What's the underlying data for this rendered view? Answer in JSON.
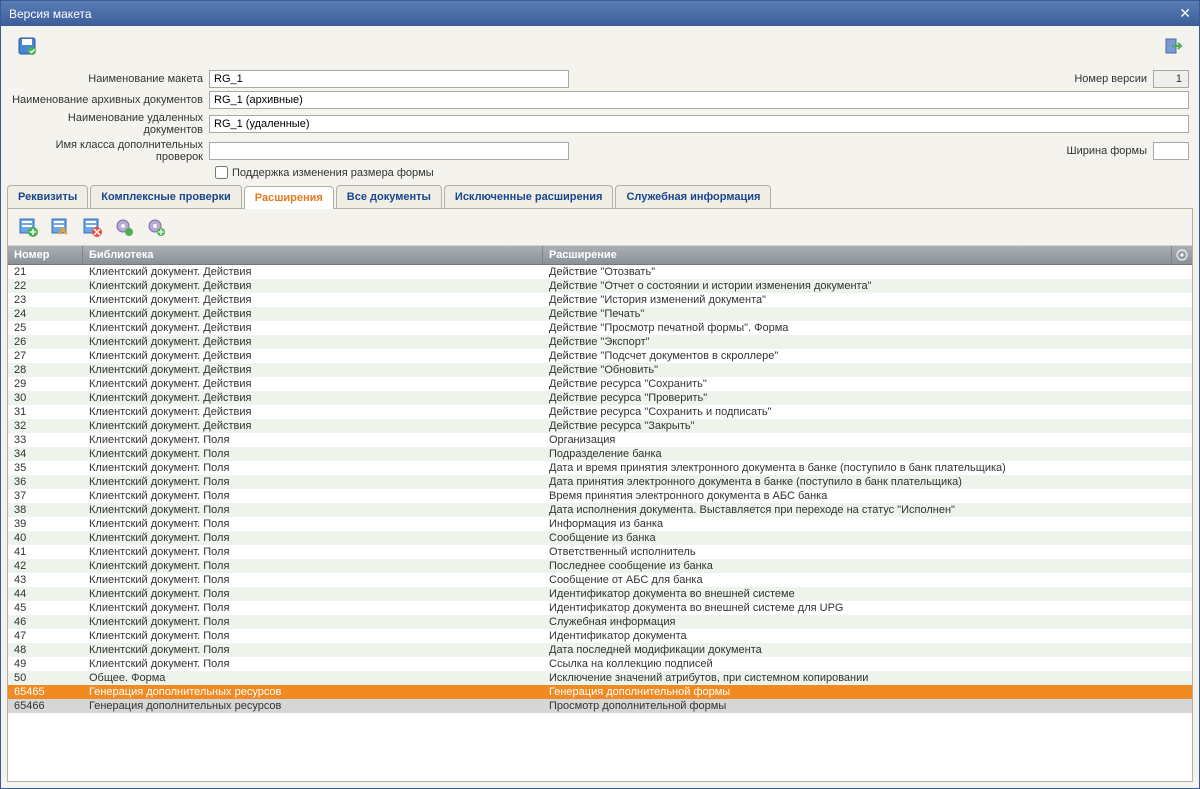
{
  "window": {
    "title": "Версия макета"
  },
  "form": {
    "label_name": "Наименование макета",
    "name_value": "RG_1",
    "label_version": "Номер версии",
    "version_value": "1",
    "label_archive": "Наименование архивных документов",
    "archive_value": "RG_1 (архивные)",
    "label_deleted": "Наименование удаленных документов",
    "deleted_value": "RG_1 (удаленные)",
    "label_class": "Имя класса дополнительных проверок",
    "class_value": "",
    "label_width": "Ширина формы",
    "width_value": "",
    "checkbox_label": "Поддержка изменения размера формы"
  },
  "tabs": [
    "Реквизиты",
    "Комплексные проверки",
    "Расширения",
    "Все документы",
    "Исключенные расширения",
    "Служебная информация"
  ],
  "grid": {
    "headers": {
      "num": "Номер",
      "lib": "Библиотека",
      "ext": "Расширение"
    },
    "rows": [
      {
        "num": "21",
        "lib": "Клиентский документ. Действия",
        "ext": "Действие \"Отозвать\""
      },
      {
        "num": "22",
        "lib": "Клиентский документ. Действия",
        "ext": "Действие \"Отчет о состоянии и истории изменения документа\""
      },
      {
        "num": "23",
        "lib": "Клиентский документ. Действия",
        "ext": "Действие \"История изменений документа\""
      },
      {
        "num": "24",
        "lib": "Клиентский документ. Действия",
        "ext": "Действие \"Печать\""
      },
      {
        "num": "25",
        "lib": "Клиентский документ. Действия",
        "ext": "Действие \"Просмотр печатной формы\". Форма"
      },
      {
        "num": "26",
        "lib": "Клиентский документ. Действия",
        "ext": "Действие \"Экспорт\""
      },
      {
        "num": "27",
        "lib": "Клиентский документ. Действия",
        "ext": "Действие \"Подсчет документов в скроллере\""
      },
      {
        "num": "28",
        "lib": "Клиентский документ. Действия",
        "ext": "Действие \"Обновить\""
      },
      {
        "num": "29",
        "lib": "Клиентский документ. Действия",
        "ext": "Действие ресурса \"Сохранить\""
      },
      {
        "num": "30",
        "lib": "Клиентский документ. Действия",
        "ext": "Действие ресурса \"Проверить\""
      },
      {
        "num": "31",
        "lib": "Клиентский документ. Действия",
        "ext": "Действие ресурса \"Сохранить и подписать\""
      },
      {
        "num": "32",
        "lib": "Клиентский документ. Действия",
        "ext": "Действие ресурса \"Закрыть\""
      },
      {
        "num": "33",
        "lib": "Клиентский документ. Поля",
        "ext": "Организация"
      },
      {
        "num": "34",
        "lib": "Клиентский документ. Поля",
        "ext": "Подразделение банка"
      },
      {
        "num": "35",
        "lib": "Клиентский документ. Поля",
        "ext": "Дата и время принятия электронного документа в банке (поступило в банк плательщика)"
      },
      {
        "num": "36",
        "lib": "Клиентский документ. Поля",
        "ext": "Дата принятия электронного документа в банке (поступило в банк плательщика)"
      },
      {
        "num": "37",
        "lib": "Клиентский документ. Поля",
        "ext": "Время принятия электронного документа в АБС банка"
      },
      {
        "num": "38",
        "lib": "Клиентский документ. Поля",
        "ext": "Дата исполнения документа. Выставляется при переходе на статус \"Исполнен\""
      },
      {
        "num": "39",
        "lib": "Клиентский документ. Поля",
        "ext": "Информация из банка"
      },
      {
        "num": "40",
        "lib": "Клиентский документ. Поля",
        "ext": "Сообщение из банка"
      },
      {
        "num": "41",
        "lib": "Клиентский документ. Поля",
        "ext": "Ответственный исполнитель"
      },
      {
        "num": "42",
        "lib": "Клиентский документ. Поля",
        "ext": "Последнее сообщение из банка"
      },
      {
        "num": "43",
        "lib": "Клиентский документ. Поля",
        "ext": "Сообщение от АБС для банка"
      },
      {
        "num": "44",
        "lib": "Клиентский документ. Поля",
        "ext": "Идентификатор документа во внешней системе"
      },
      {
        "num": "45",
        "lib": "Клиентский документ. Поля",
        "ext": "Идентификатор документа во внешней системе для UPG"
      },
      {
        "num": "46",
        "lib": "Клиентский документ. Поля",
        "ext": "Служебная информация"
      },
      {
        "num": "47",
        "lib": "Клиентский документ. Поля",
        "ext": "Идентификатор документа"
      },
      {
        "num": "48",
        "lib": "Клиентский документ. Поля",
        "ext": "Дата последней модификации документа"
      },
      {
        "num": "49",
        "lib": "Клиентский документ. Поля",
        "ext": "Ссылка на коллекцию подписей"
      },
      {
        "num": "50",
        "lib": "Общее. Форма",
        "ext": "Исключение значений атрибутов, при системном копировании"
      },
      {
        "num": "65465",
        "lib": "Генерация дополнительных ресурсов",
        "ext": "Генерация дополнительной формы",
        "sel": true
      },
      {
        "num": "65466",
        "lib": "Генерация дополнительных ресурсов",
        "ext": "Просмотр дополнительной формы",
        "sel2": true
      }
    ]
  }
}
